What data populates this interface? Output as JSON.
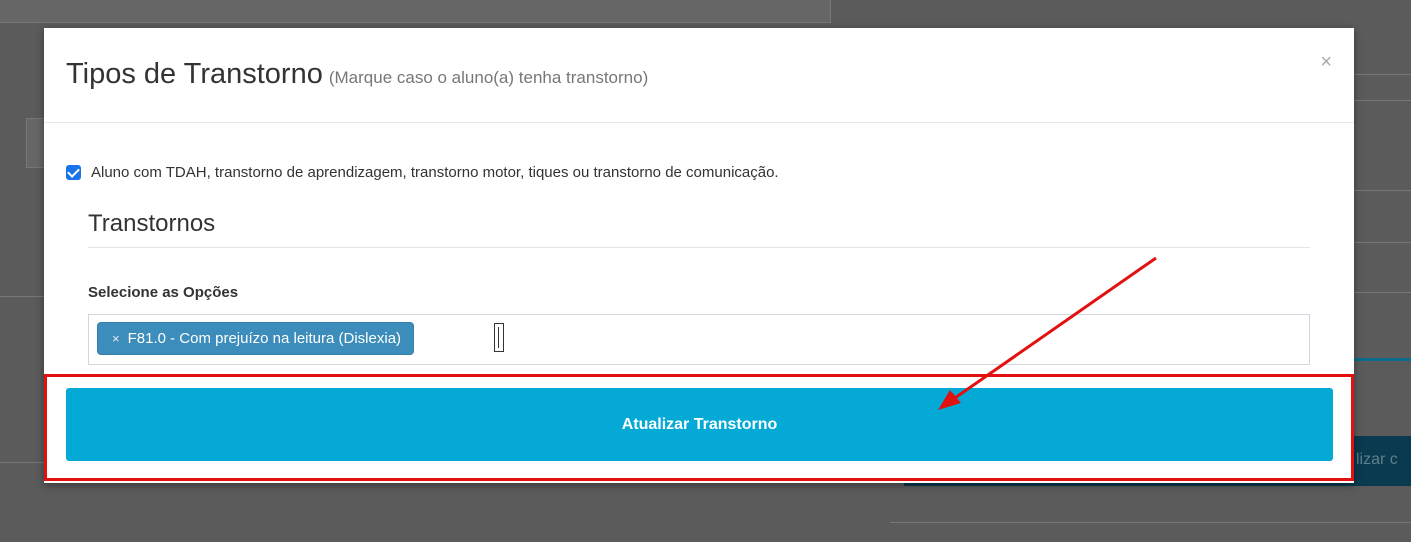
{
  "background": {
    "right_button_fragment": "lizar c"
  },
  "modal": {
    "title": "Tipos de Transtorno",
    "subtitle": "(Marque caso o aluno(a) tenha transtorno)",
    "close_label": "×",
    "checkbox": {
      "checked": true,
      "label": "Aluno com TDAH, transtorno de aprendizagem, transtorno motor, tiques ou transtorno de comunicação."
    },
    "section_title": "Transtornos",
    "select": {
      "label": "Selecione as Opções",
      "tags": [
        {
          "remove": "×",
          "label": "F81.0 - Com prejuízo na leitura (Dislexia)"
        }
      ]
    },
    "submit_label": "Atualizar Transtorno"
  },
  "annotation": {
    "highlight_color": "#e31010",
    "arrow_color": "#e31010"
  },
  "colors": {
    "primary_button": "#04a9d6",
    "tag": "#3c8dbc",
    "checkbox": "#1a73e8"
  }
}
